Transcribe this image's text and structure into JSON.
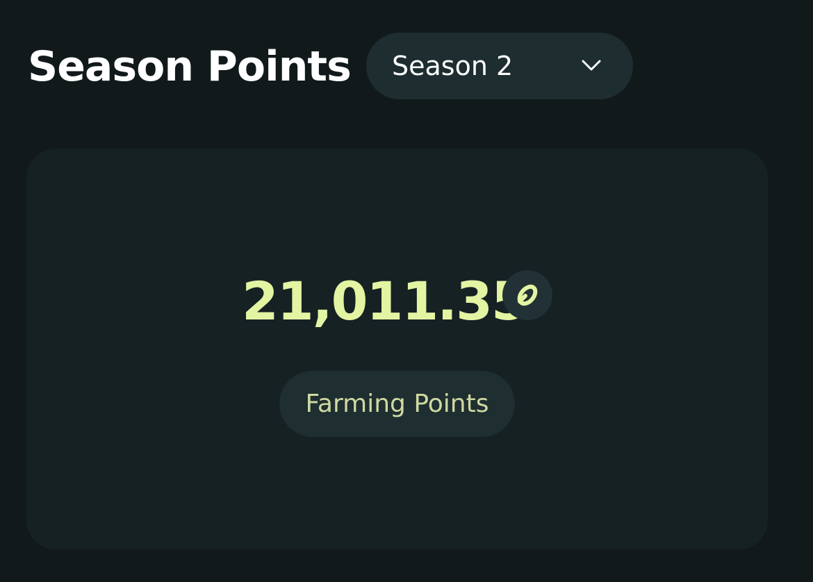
{
  "header": {
    "title": "Season Points"
  },
  "season_selector": {
    "selected": "Season 2",
    "icon": "chevron-down-icon"
  },
  "points_card": {
    "value": "21,011.35",
    "token_icon": "token-logo-icon",
    "category_label": "Farming Points"
  },
  "colors": {
    "background": "#11191b",
    "card": "#162123",
    "pill": "#1f2e30",
    "accent": "#e3f4a3",
    "text": "#ffffff"
  }
}
